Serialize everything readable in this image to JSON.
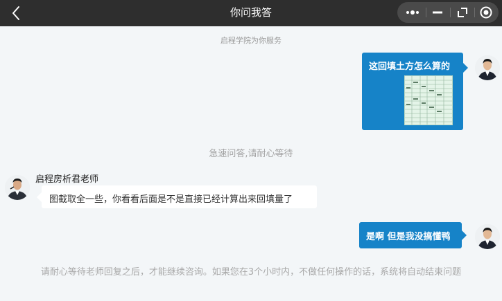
{
  "window": {
    "title": "你问我答",
    "capsule_icons": [
      "more-icon",
      "minimize-icon",
      "restore-icon",
      "close-circle-icon"
    ]
  },
  "messages": {
    "top_notice": "启程学院为你服务",
    "user_msg_1": "这回填土方怎么算的",
    "mid_notice": "急速问答,请耐心等待",
    "teacher_name": "启程房析君老师",
    "teacher_msg": "图截取全一些，你看看后面是不是直接已经计算出来回填量了",
    "user_msg_2": "是啊 但是我没搞懂鸭",
    "bottom_notice": "请耐心等待老师回复之后，才能继续咨询。如果您在3个小时内，不做任何操作的话，系统将自动结束问题"
  },
  "colors": {
    "titlebar": "#2e2e2e",
    "user_bubble": "#1683c8",
    "background": "#f3f6f8"
  }
}
